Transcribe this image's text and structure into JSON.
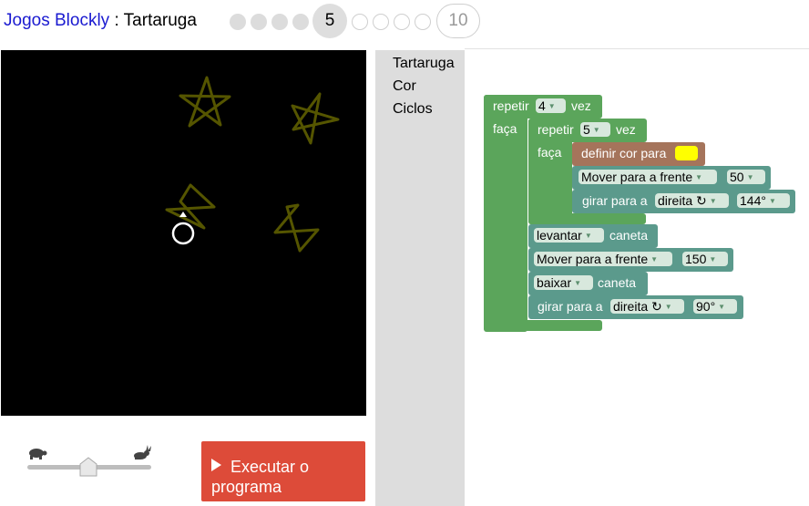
{
  "header": {
    "game_title": "Jogos Blockly",
    "separator": " : ",
    "puzzle_title": "Tartaruga",
    "current_level": "5",
    "last_level": "10"
  },
  "toolbox": {
    "categories": [
      "Tartaruga",
      "Cor",
      "Ciclos"
    ]
  },
  "run_button": {
    "label": "Executar o programa",
    "color": "#dd4b39"
  },
  "speed_slider": {
    "slow_icon": "turtle-icon",
    "fast_icon": "rabbit-icon",
    "value": 0.5
  },
  "canvas": {
    "star_color": "#555500",
    "turtle_color": "#ffffff"
  },
  "program": {
    "outer_repeat": {
      "keyword": "repetir",
      "count": "4",
      "suffix": "vez",
      "do": "faça"
    },
    "inner_repeat": {
      "keyword": "repetir",
      "count": "5",
      "suffix": "vez",
      "do": "faça"
    },
    "set_color": {
      "label": "definir cor para",
      "color": "#ffff00"
    },
    "move_inner": {
      "label": "Mover para a frente",
      "value": "50"
    },
    "turn_inner": {
      "label": "girar para a",
      "direction": "direita ↻",
      "value": "144°"
    },
    "pen_up": {
      "mode": "levantar",
      "label": "caneta"
    },
    "move_outer": {
      "label": "Mover para a frente",
      "value": "150"
    },
    "pen_down": {
      "mode": "baixar",
      "label": "caneta"
    },
    "turn_outer": {
      "label": "girar para a",
      "direction": "direita ↻",
      "value": "90°"
    }
  }
}
